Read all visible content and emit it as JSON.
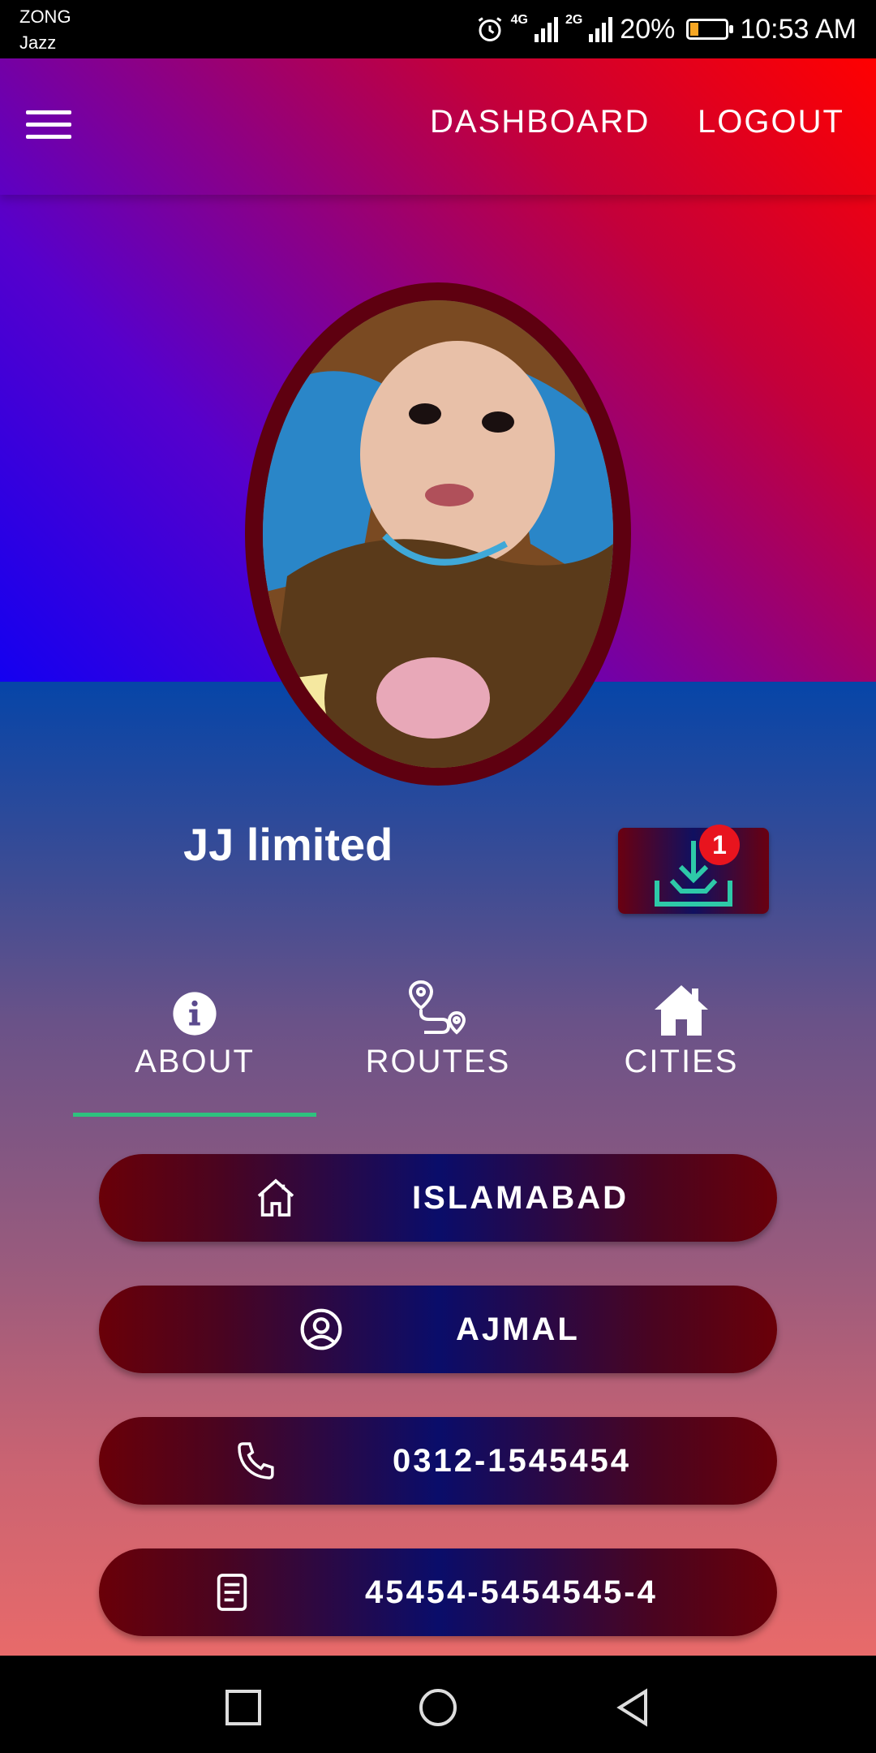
{
  "status_bar": {
    "carrier_primary": "ZONG",
    "carrier_secondary": "Jazz",
    "network1": "4G",
    "network2": "2G",
    "battery_text": "20%",
    "battery_level": 0.2,
    "time": "10:53 AM"
  },
  "header": {
    "dashboard_label": "DASHBOARD",
    "logout_label": "LOGOUT"
  },
  "profile": {
    "company_name": "JJ limited",
    "download_badge": "1"
  },
  "tabs": [
    {
      "label": "ABOUT",
      "icon": "info-icon",
      "active": true
    },
    {
      "label": "ROUTES",
      "icon": "route-icon",
      "active": false
    },
    {
      "label": "CITIES",
      "icon": "home-icon",
      "active": false
    }
  ],
  "info": {
    "city": "ISLAMABAD",
    "owner": "AJMAL",
    "phone": "0312-1545454",
    "id_number": "45454-5454545-4"
  },
  "colors": {
    "active_tab_indicator": "#2ec27e",
    "badge": "#e8141e",
    "download_icon": "#2ec9a8"
  }
}
